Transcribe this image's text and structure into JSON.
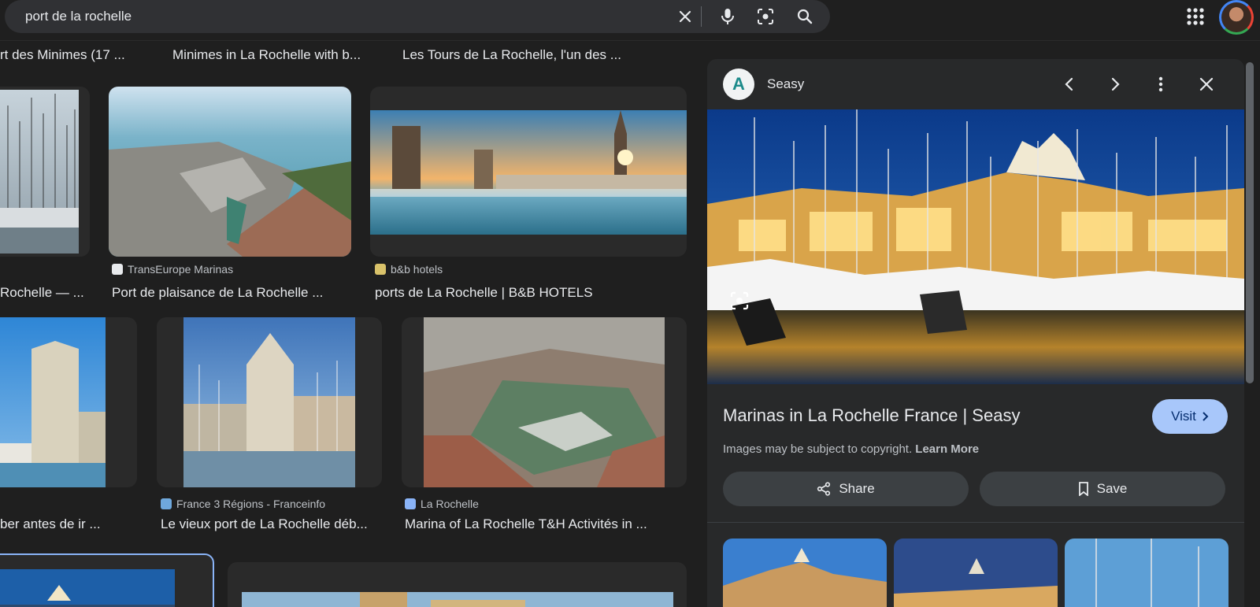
{
  "search": {
    "query": "port de la rochelle",
    "icons": [
      "close-icon",
      "microphone-icon",
      "camera-lens-icon",
      "search-icon"
    ]
  },
  "header": {
    "icons": [
      "apps-grid-icon",
      "avatar"
    ]
  },
  "top_row": [
    {
      "title": "rt des Minimes (17 ..."
    },
    {
      "title": "Minimes in La Rochelle with b..."
    },
    {
      "title": "Les Tours de La Rochelle, l'un des ..."
    }
  ],
  "row1": [
    {
      "source": "",
      "title": "Rochelle — ..."
    },
    {
      "source": "TransEurope Marinas",
      "title": "Port de plaisance de La Rochelle ..."
    },
    {
      "source": "b&b hotels",
      "title": "ports de La Rochelle | B&B HOTELS"
    }
  ],
  "row2": [
    {
      "source": "",
      "title": "ber antes de ir ..."
    },
    {
      "source": "France 3 Régions - Franceinfo",
      "title": "Le vieux port de La Rochelle déb..."
    },
    {
      "source": "La Rochelle",
      "title": "Marina of La Rochelle T&H Activités in ..."
    }
  ],
  "panel": {
    "site_name": "Seasy",
    "logo_letter": "A",
    "title": "Marinas in La Rochelle France | Seasy",
    "visit_label": "Visit",
    "copyright_text": "Images may be subject to copyright.",
    "learn_more": "Learn More",
    "share_label": "Share",
    "save_label": "Save"
  },
  "colors": {
    "accent": "#a8c7fa",
    "background": "#1f1f1f",
    "panel": "#28292a"
  }
}
